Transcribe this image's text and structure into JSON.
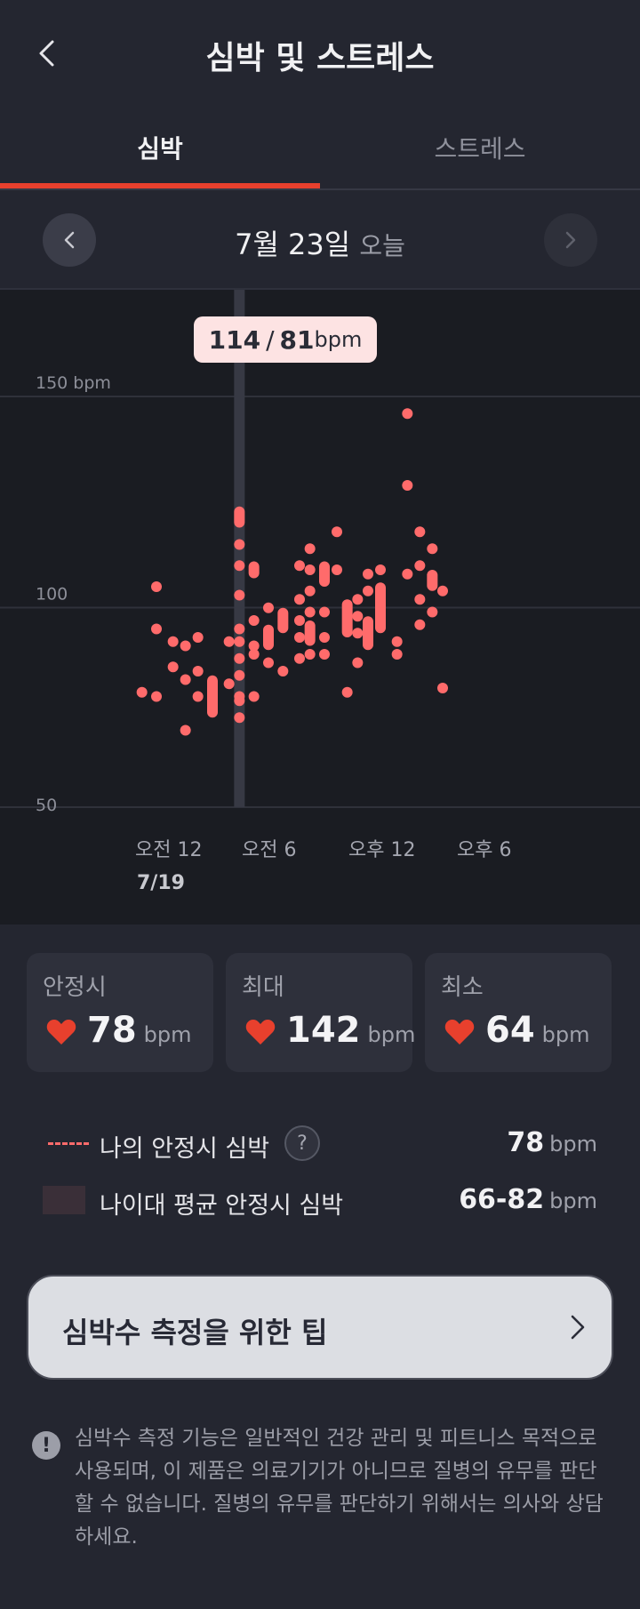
{
  "header": {
    "title": "심박 및 스트레스",
    "back_icon": "chevron-left-icon"
  },
  "tabs": [
    {
      "label": "심박",
      "active": true
    },
    {
      "label": "스트레스",
      "active": false
    }
  ],
  "accent_color": "#e8402d",
  "date_nav": {
    "date": "7월 23일",
    "today_label": "오늘"
  },
  "chart_data": {
    "type": "range",
    "y_axis_labels": [
      "150 bpm",
      "100",
      "50"
    ],
    "ylim": [
      50,
      150
    ],
    "x_tick_labels": [
      "오전 12",
      "오전 6",
      "오후 12",
      "오후 6"
    ],
    "x_sub_label": "7/19",
    "tooltip": {
      "max": "114",
      "separator": "/",
      "min": "81",
      "unit": "bpm"
    },
    "series_color": "#ff6b6b",
    "hours": 24,
    "selected_hour": 5.2,
    "columns": [
      {
        "hour": 0.5,
        "values": [
          81
        ]
      },
      {
        "hour": 1.2,
        "values": [
          80,
          106,
          96
        ]
      },
      {
        "hour": 2.0,
        "values": [
          93,
          87
        ]
      },
      {
        "hour": 2.6,
        "values": [
          92,
          84,
          72
        ]
      },
      {
        "hour": 3.2,
        "values": [
          94,
          80,
          86
        ]
      },
      {
        "hour": 3.9,
        "range": [
          75,
          85
        ]
      },
      {
        "hour": 4.7,
        "values": [
          83,
          93
        ]
      },
      {
        "hour": 5.2,
        "range": [
          120,
          125
        ],
        "values": [
          116,
          111,
          104,
          96,
          93,
          89,
          85,
          80,
          79,
          75
        ]
      },
      {
        "hour": 5.9,
        "range": [
          108,
          112
        ],
        "values": [
          98,
          92,
          90,
          80
        ]
      },
      {
        "hour": 6.6,
        "range": [
          91,
          97
        ],
        "values": [
          101,
          88
        ]
      },
      {
        "hour": 7.3,
        "range": [
          95,
          101
        ],
        "values": [
          86
        ]
      },
      {
        "hour": 8.1,
        "values": [
          111,
          103,
          98,
          94,
          89
        ]
      },
      {
        "hour": 8.6,
        "range": [
          92,
          98
        ],
        "values": [
          115,
          110,
          105,
          100,
          90
        ]
      },
      {
        "hour": 9.3,
        "range": [
          106,
          112
        ],
        "values": [
          100,
          94,
          90
        ]
      },
      {
        "hour": 9.9,
        "values": [
          119,
          110
        ]
      },
      {
        "hour": 10.4,
        "range": [
          94,
          103
        ],
        "values": [
          81
        ]
      },
      {
        "hour": 10.9,
        "values": [
          103,
          99,
          95,
          88
        ]
      },
      {
        "hour": 11.4,
        "range": [
          91,
          99
        ],
        "values": [
          109,
          105
        ]
      },
      {
        "hour": 12.0,
        "range": [
          95,
          107
        ],
        "values": [
          110
        ]
      },
      {
        "hour": 12.8,
        "values": [
          93,
          90
        ]
      },
      {
        "hour": 13.3,
        "values": [
          147,
          130,
          109
        ]
      },
      {
        "hour": 13.9,
        "values": [
          119,
          111,
          103,
          97
        ]
      },
      {
        "hour": 14.5,
        "range": [
          105,
          110
        ],
        "values": [
          115,
          100
        ]
      },
      {
        "hour": 15.0,
        "values": [
          105,
          82
        ]
      }
    ]
  },
  "stats": [
    {
      "label": "안정시",
      "value": "78",
      "unit": "bpm"
    },
    {
      "label": "최대",
      "value": "142",
      "unit": "bpm"
    },
    {
      "label": "최소",
      "value": "64",
      "unit": "bpm"
    }
  ],
  "legend": {
    "resting": {
      "label": "나의 안정시 심박",
      "value": "78",
      "unit": "bpm",
      "help": "?"
    },
    "age_avg": {
      "label": "나이대 평균 안정시 심박",
      "value": "66-82",
      "unit": "bpm"
    }
  },
  "tip_button": {
    "label": "심박수 측정을 위한 팁"
  },
  "notice": {
    "icon": "!",
    "text": "심박수 측정 기능은 일반적인 건강 관리 및 피트니스 목적으로 사용되며, 이 제품은 의료기기가 아니므로 질병의 유무를 판단할 수 없습니다. 질병의 유무를 판단하기 위해서는 의사와 상담하세요."
  }
}
